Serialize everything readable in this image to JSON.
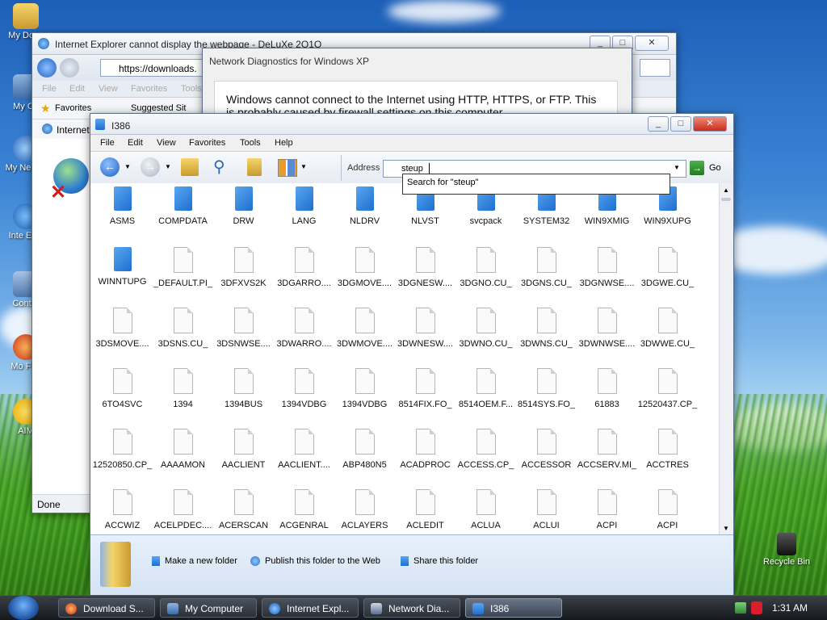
{
  "ie_window": {
    "title": "Internet Explorer cannot display the webpage - DeLuXe 2O1O",
    "address": "https://downloads.",
    "menu": [
      "File",
      "Edit",
      "View",
      "Favorites",
      "Tools"
    ],
    "favorites_label": "Favorites",
    "suggested_label": "Suggested Sit",
    "tab_label": "Internet",
    "status": "Done"
  },
  "diag_window": {
    "title": "Network Diagnostics for Windows XP",
    "message": "Windows cannot connect to the Internet using HTTP, HTTPS, or FTP. This is probably caused by firewall settings on this computer."
  },
  "explorer": {
    "title": "I386",
    "menu": [
      "File",
      "Edit",
      "View",
      "Favorites",
      "Tools",
      "Help"
    ],
    "address_label": "Address",
    "address_value": "steup",
    "go_label": "Go",
    "suggestion": "Search for \"steup\"",
    "items": [
      {
        "name": "ASMS",
        "type": "folder"
      },
      {
        "name": "COMPDATA",
        "type": "folder"
      },
      {
        "name": "DRW",
        "type": "folder"
      },
      {
        "name": "LANG",
        "type": "folder"
      },
      {
        "name": "NLDRV",
        "type": "folder"
      },
      {
        "name": "NLVST",
        "type": "folder"
      },
      {
        "name": "svcpack",
        "type": "folder"
      },
      {
        "name": "SYSTEM32",
        "type": "folder"
      },
      {
        "name": "WIN9XMIG",
        "type": "folder"
      },
      {
        "name": "WIN9XUPG",
        "type": "folder"
      },
      {
        "name": "WINNTUPG",
        "type": "folder"
      },
      {
        "name": "_DEFAULT.PI_",
        "type": "file"
      },
      {
        "name": "3DFXVS2K",
        "type": "file"
      },
      {
        "name": "3DGARRO....",
        "type": "file"
      },
      {
        "name": "3DGMOVE....",
        "type": "file"
      },
      {
        "name": "3DGNESW....",
        "type": "file"
      },
      {
        "name": "3DGNO.CU_",
        "type": "file"
      },
      {
        "name": "3DGNS.CU_",
        "type": "file"
      },
      {
        "name": "3DGNWSE....",
        "type": "file"
      },
      {
        "name": "3DGWE.CU_",
        "type": "file"
      },
      {
        "name": "3DSMOVE....",
        "type": "file"
      },
      {
        "name": "3DSNS.CU_",
        "type": "file"
      },
      {
        "name": "3DSNWSE....",
        "type": "file"
      },
      {
        "name": "3DWARRO....",
        "type": "file"
      },
      {
        "name": "3DWMOVE....",
        "type": "file"
      },
      {
        "name": "3DWNESW....",
        "type": "file"
      },
      {
        "name": "3DWNO.CU_",
        "type": "file"
      },
      {
        "name": "3DWNS.CU_",
        "type": "file"
      },
      {
        "name": "3DWNWSE....",
        "type": "file"
      },
      {
        "name": "3DWWE.CU_",
        "type": "file"
      },
      {
        "name": "6TO4SVC",
        "type": "file"
      },
      {
        "name": "1394",
        "type": "file"
      },
      {
        "name": "1394BUS",
        "type": "file"
      },
      {
        "name": "1394VDBG",
        "type": "file"
      },
      {
        "name": "1394VDBG",
        "type": "file"
      },
      {
        "name": "8514FIX.FO_",
        "type": "file"
      },
      {
        "name": "8514OEM.F...",
        "type": "file"
      },
      {
        "name": "8514SYS.FO_",
        "type": "file"
      },
      {
        "name": "61883",
        "type": "file"
      },
      {
        "name": "12520437.CP_",
        "type": "file"
      },
      {
        "name": "12520850.CP_",
        "type": "file"
      },
      {
        "name": "AAAAMON",
        "type": "file"
      },
      {
        "name": "AACLIENT",
        "type": "file"
      },
      {
        "name": "AACLIENT....",
        "type": "file"
      },
      {
        "name": "ABP480N5",
        "type": "file"
      },
      {
        "name": "ACADPROC",
        "type": "file"
      },
      {
        "name": "ACCESS.CP_",
        "type": "file"
      },
      {
        "name": "ACCESSOR",
        "type": "file"
      },
      {
        "name": "ACCSERV.MI_",
        "type": "file"
      },
      {
        "name": "ACCTRES",
        "type": "file"
      },
      {
        "name": "ACCWIZ",
        "type": "file"
      },
      {
        "name": "ACELPDEC....",
        "type": "file"
      },
      {
        "name": "ACERSCAN",
        "type": "file"
      },
      {
        "name": "ACGENRAL",
        "type": "file"
      },
      {
        "name": "ACLAYERS",
        "type": "file"
      },
      {
        "name": "ACLEDIT",
        "type": "file"
      },
      {
        "name": "ACLUA",
        "type": "file"
      },
      {
        "name": "ACLUI",
        "type": "file"
      },
      {
        "name": "ACPI",
        "type": "file"
      },
      {
        "name": "ACPI",
        "type": "file"
      }
    ],
    "tasks": [
      "Make a new folder",
      "Publish this folder to the Web",
      "Share this folder"
    ]
  },
  "desktop_icons": [
    "My Docu",
    "My Co",
    "My Ne Pla",
    "Inte Expl",
    "Contro",
    "Mo Fire",
    "AIM"
  ],
  "recycle_bin": "Recycle Bin",
  "taskbar": {
    "tasks": [
      "Download S...",
      "My Computer",
      "Internet Expl...",
      "Network Dia...",
      "I386"
    ],
    "clock": "1:31 AM"
  }
}
